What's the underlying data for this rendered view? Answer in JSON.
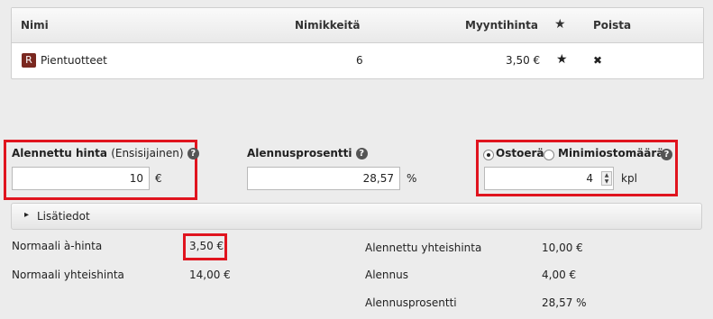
{
  "table": {
    "headers": {
      "name": "Nimi",
      "items": "Nimikkeitä",
      "price": "Myyntihinta",
      "star": "★",
      "delete": "Poista"
    },
    "row": {
      "badge": "R",
      "name": "Pientuotteet",
      "items": "6",
      "price": "3,50 €",
      "star": "★",
      "delete": "✖"
    }
  },
  "discount": {
    "price_label": "Alennettu hinta",
    "price_sub": "(Ensisijainen)",
    "price_value": "10",
    "price_unit": "€",
    "percent_label": "Alennusprosentti",
    "percent_value": "28,57",
    "percent_unit": "%",
    "radio_buy": "Ostoerä",
    "radio_min": "Minimiostomäärä",
    "qty_value": "4",
    "qty_unit": "kpl",
    "help": "?"
  },
  "accordion": {
    "label": "Lisätiedot",
    "arrow": "▸"
  },
  "summary": {
    "normal_unit_label": "Normaali à-hinta",
    "normal_unit_value": "3,50 €",
    "normal_total_label": "Normaali yhteishinta",
    "normal_total_value": "14,00 €",
    "disc_total_label": "Alennettu yhteishinta",
    "disc_total_value": "10,00 €",
    "discount_label": "Alennus",
    "discount_value": "4,00 €",
    "disc_pct_label": "Alennusprosentti",
    "disc_pct_value": "28,57 %"
  }
}
